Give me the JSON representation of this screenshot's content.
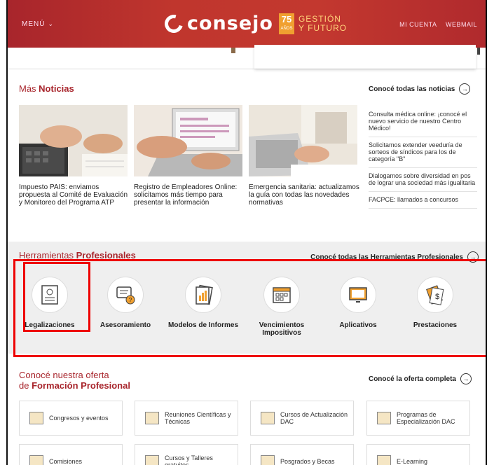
{
  "header": {
    "menu_label": "MENÚ",
    "logo_word": "consejo",
    "badge_number": "75",
    "badge_years": "AÑOS",
    "tagline_line1": "GESTIÓN",
    "tagline_line2": "Y FUTURO",
    "my_account": "MI CUENTA",
    "webmail": "WEBMAIL"
  },
  "news": {
    "title_light": "Más ",
    "title_bold": "Noticias",
    "see_all": "Conocé todas las noticias",
    "items": [
      {
        "text": "Impuesto PAIS: enviamos propuesta al Comité de Evaluación y Monitoreo del Programa ATP"
      },
      {
        "text": "Registro de Empleadores Online: solicitamos más tiempo para presentar la información"
      },
      {
        "text": "Emergencia sanitaria: actualizamos la guía con todas las novedades normativas"
      }
    ],
    "side": [
      "Consulta médica online: ¡conocé el nuevo servicio de nuestro Centro Médico!",
      "Solicitamos extender veeduría de sorteos de síndicos para los de categoría \"B\"",
      "Dialogamos sobre diversidad en pos de lograr una sociedad más igualitaria",
      "FACPCE: llamados a concursos"
    ]
  },
  "tools": {
    "title_light": "Herramientas ",
    "title_bold": "Profesionales",
    "see_all": "Conocé todas las Herramientas Profesionales",
    "items": [
      {
        "label": "Legalizaciones",
        "icon": "document-icon"
      },
      {
        "label": "Asesoramiento",
        "icon": "chat-help-icon"
      },
      {
        "label": "Modelos de Informes",
        "icon": "report-chart-icon"
      },
      {
        "label": "Vencimientos Impositivos",
        "icon": "calendar-icon"
      },
      {
        "label": "Aplicativos",
        "icon": "monitor-icon"
      },
      {
        "label": "Prestaciones",
        "icon": "money-tag-icon"
      }
    ]
  },
  "training": {
    "title_line1": "Conocé nuestra oferta",
    "title_prefix": "de ",
    "title_bold": "Formación Profesional",
    "see_all": "Conocé la oferta completa",
    "cards": [
      "Congresos y eventos",
      "Reuniones Científicas y Técnicas",
      "Cursos de Actualización DAC",
      "Programas de Especialización DAC",
      "Comisiones",
      "Cursos y Talleres gratuitos",
      "Posgrados y Becas",
      "E-Learning"
    ]
  }
}
